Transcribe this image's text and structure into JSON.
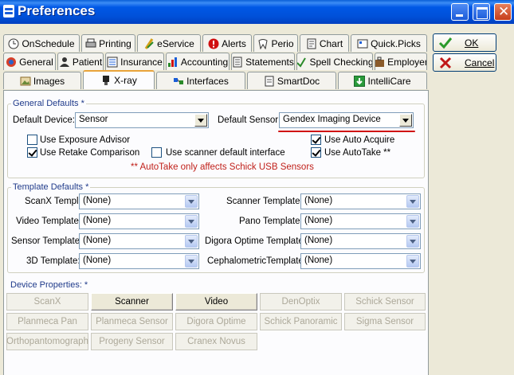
{
  "window": {
    "title": "Preferences"
  },
  "tabs_row1": [
    "OnSchedule",
    "Printing",
    "eService",
    "Alerts",
    "Perio",
    "Chart",
    "Quick.Picks"
  ],
  "tabs_row2": [
    "General",
    "Patient",
    "Insurance",
    "Accounting",
    "Statements",
    "Spell Checking",
    "Employer"
  ],
  "tabs_row3": [
    "Images",
    "X-ray",
    "Interfaces",
    "SmartDoc",
    "IntelliCare"
  ],
  "actions": {
    "ok": "OK",
    "cancel": "Cancel"
  },
  "general_defaults": {
    "title": "General Defaults *",
    "device_label": "Default Device:",
    "device_value": "Sensor",
    "sensor_label": "Default Sensor:",
    "sensor_value": "Gendex Imaging Device",
    "checkboxes": {
      "exposure_advisor": {
        "label": "Use Exposure Advisor",
        "checked": false
      },
      "retake_comparison": {
        "label": "Use Retake Comparison",
        "checked": true
      },
      "scanner_default": {
        "label": "Use scanner default interface",
        "checked": false
      },
      "auto_acquire": {
        "label": "Use Auto Acquire",
        "checked": true
      },
      "auto_take": {
        "label": "Use AutoTake **",
        "checked": true
      }
    },
    "note": "** AutoTake only affects Schick USB Sensors"
  },
  "template_defaults": {
    "title": "Template Defaults *",
    "left": [
      {
        "label": "ScanX Template:",
        "value": "(None)"
      },
      {
        "label": "Video Template:",
        "value": "(None)"
      },
      {
        "label": "Sensor Template:",
        "value": "(None)"
      },
      {
        "label": "3D Template:",
        "value": "(None)"
      }
    ],
    "right": [
      {
        "label": "Scanner Template:",
        "value": "(None)"
      },
      {
        "label": "Pano Template:",
        "value": "(None)"
      },
      {
        "label": "Digora Optime Template:",
        "value": "(None)"
      },
      {
        "label": "CephalometricTemplate:",
        "value": "(None)"
      }
    ]
  },
  "device_properties": {
    "title": "Device Properties: *",
    "buttons": [
      {
        "label": "ScanX",
        "enabled": false
      },
      {
        "label": "Scanner",
        "enabled": true
      },
      {
        "label": "Video",
        "enabled": true
      },
      {
        "label": "DenOptix",
        "enabled": false
      },
      {
        "label": "Schick Sensor",
        "enabled": false
      },
      {
        "label": "Planmeca Pan",
        "enabled": false
      },
      {
        "label": "Planmeca Sensor",
        "enabled": false
      },
      {
        "label": "Digora Optime",
        "enabled": false
      },
      {
        "label": "Schick Panoramic",
        "enabled": false
      },
      {
        "label": "Sigma Sensor",
        "enabled": false
      },
      {
        "label": "Orthopantomograph",
        "enabled": false
      },
      {
        "label": "Progeny Sensor",
        "enabled": false
      },
      {
        "label": "Cranex Novus",
        "enabled": false
      }
    ]
  },
  "colors": {
    "titlebar": "#0058e6",
    "panel": "#ece9d8",
    "note_red": "#c0201a",
    "annotation": "#d01010"
  }
}
